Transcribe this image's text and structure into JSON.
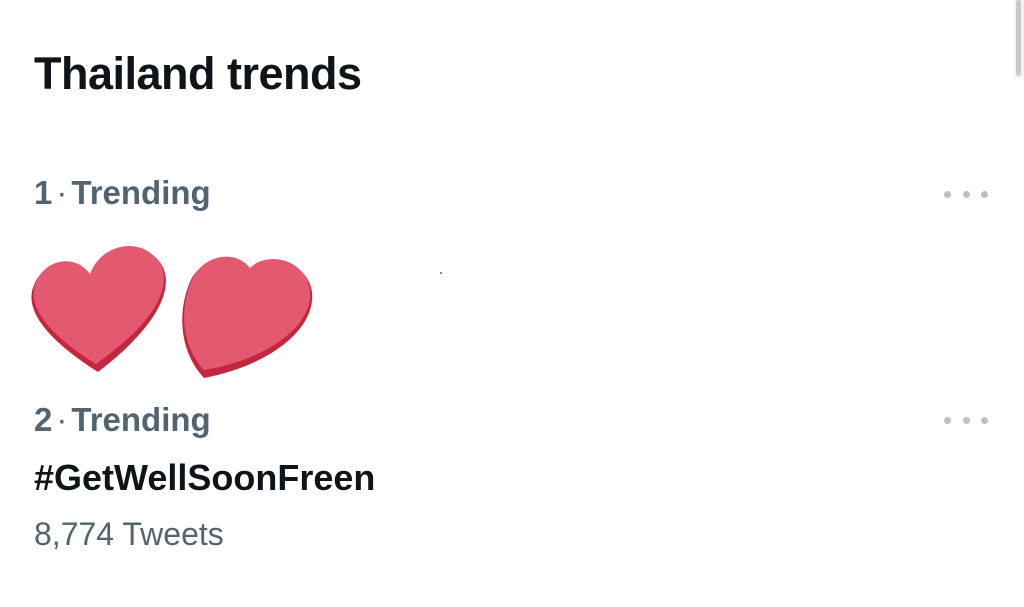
{
  "section": {
    "title": "Thailand trends"
  },
  "trends": [
    {
      "rank": "1",
      "separator": "·",
      "context": "Trending",
      "name": "",
      "covered_by": "heart-stickers"
    },
    {
      "rank": "2",
      "separator": "·",
      "context": "Trending",
      "name": "#GetWellSoonFreen",
      "count": "8,774 Tweets"
    }
  ],
  "colors": {
    "primary_text": "#0f1419",
    "secondary_text": "#536471",
    "more_dots": "#b8c1c9",
    "heart_fill": "#e35a70",
    "heart_shadow": "#c4263f"
  },
  "icons": {
    "more": "more-horizontal-icon",
    "sticker": "heart-icon"
  }
}
